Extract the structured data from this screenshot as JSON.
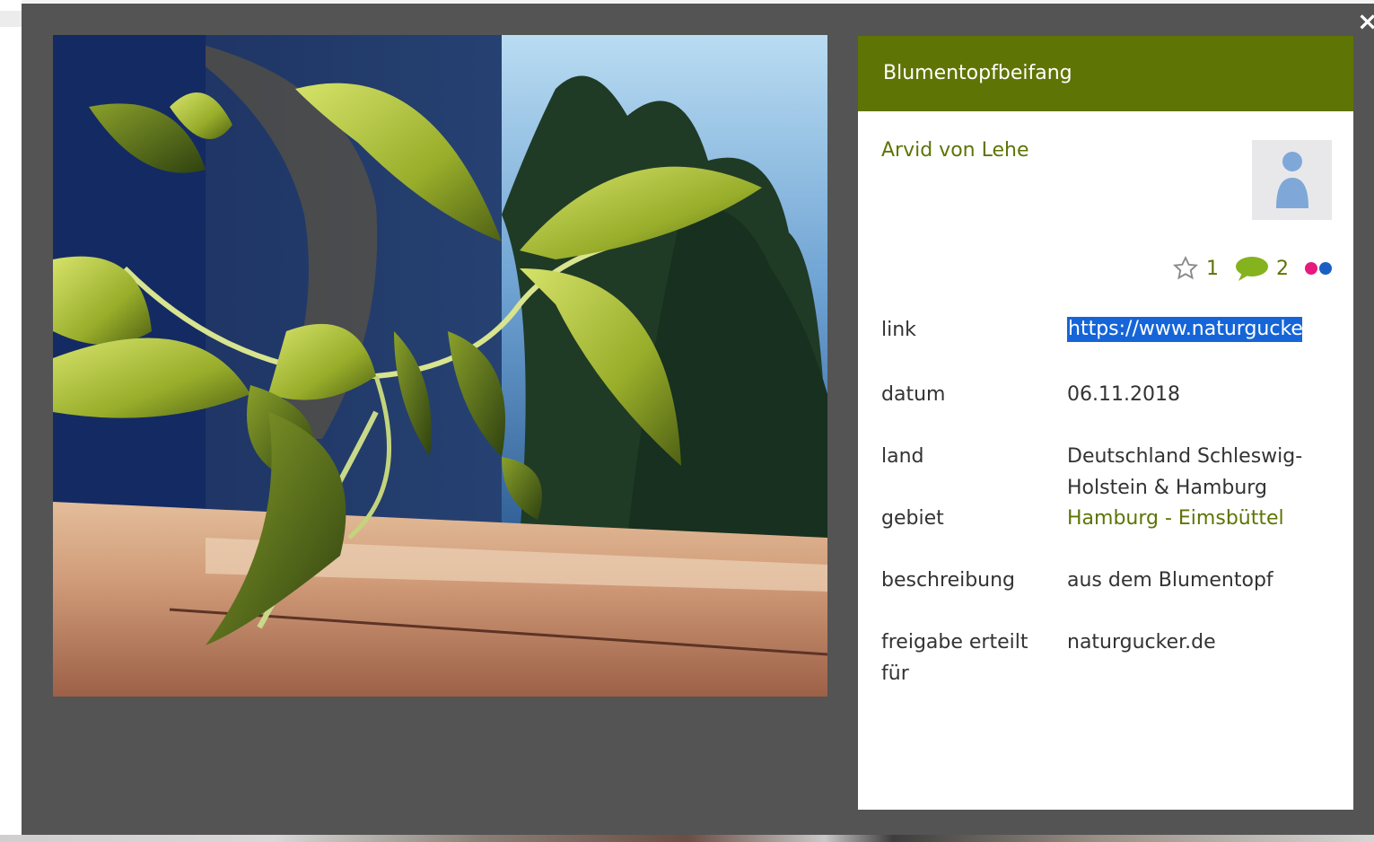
{
  "modal": {
    "close_symbol": "×"
  },
  "panel": {
    "title": "Blumentopfbeifang",
    "author": "Arvid von Lehe",
    "stats": {
      "stars": "1",
      "comments": "2",
      "star_icon": "star-outline-icon",
      "comment_icon": "speech-bubble-icon",
      "flickr_icon": "two-dots-icon",
      "dot_colors": [
        "#e6197e",
        "#1a5fc4"
      ]
    },
    "fields": {
      "link_label": "link",
      "link_value": "https://www.naturgucker.de",
      "datum_label": "datum",
      "datum_value": "06.11.2018",
      "land_label": "land",
      "land_value": "Deutschland Schleswig-Holstein & Hamburg",
      "gebiet_label": "gebiet",
      "gebiet_value": "Hamburg - Eimsbüttel",
      "beschreibung_label": "beschreibung",
      "beschreibung_value": "aus dem Blumentopf",
      "freigabe_label": "freigabe erteilt für",
      "freigabe_value": "naturgucker.de"
    }
  },
  "colors": {
    "accent_green": "#5e7405",
    "modal_bg": "#545454",
    "link_highlight": "#1565d8"
  }
}
